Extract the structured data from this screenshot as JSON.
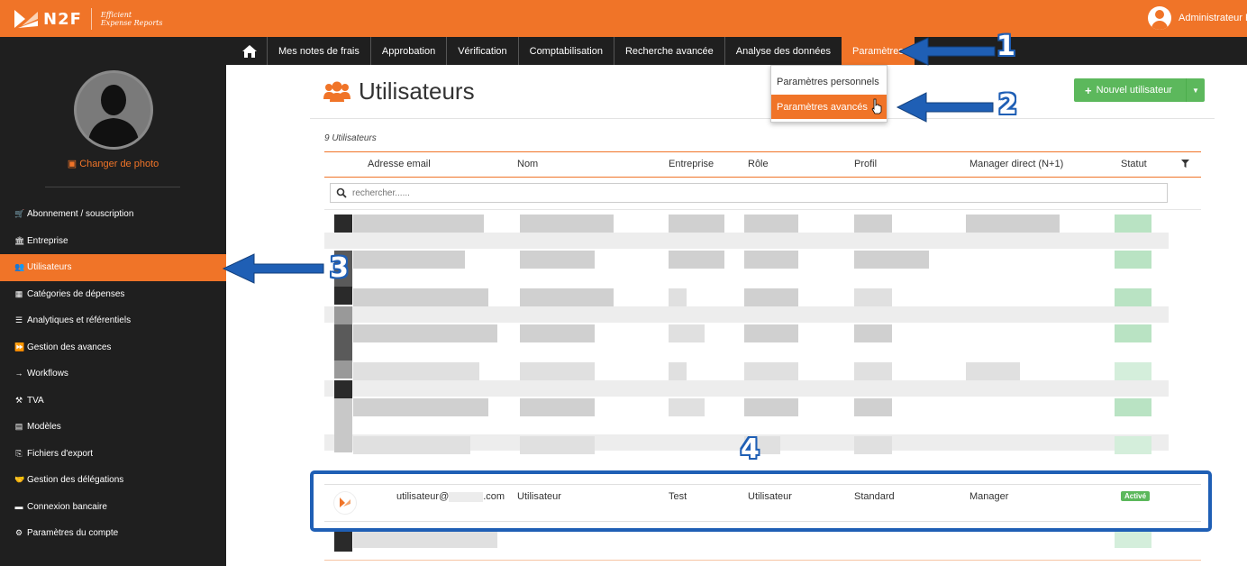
{
  "topbar": {
    "logo_text": "N2F",
    "tagline_1": "Efficient",
    "tagline_2": "Expense Reports",
    "user_label": "Administrateur R"
  },
  "nav": {
    "items": [
      "Mes notes de frais",
      "Approbation",
      "Vérification",
      "Comptabilisation",
      "Recherche avancée",
      "Analyse des données",
      "Paramètres"
    ],
    "active": "Paramètres"
  },
  "dropdown": {
    "items": [
      "Paramètres personnels",
      "Paramètres avancés"
    ],
    "active": "Paramètres avancés"
  },
  "sidebar": {
    "change_photo": "Changer de photo",
    "items": [
      {
        "label": "Abonnement / souscription",
        "icon": "cart-icon"
      },
      {
        "label": "Entreprise",
        "icon": "bank-icon"
      },
      {
        "label": "Utilisateurs",
        "icon": "users-icon"
      },
      {
        "label": "Catégories de dépenses",
        "icon": "grid-icon"
      },
      {
        "label": "Analytiques et référentiels",
        "icon": "list-icon"
      },
      {
        "label": "Gestion des avances",
        "icon": "fast-forward-icon"
      },
      {
        "label": "Workflows",
        "icon": "arrow-right-icon"
      },
      {
        "label": "TVA",
        "icon": "gavel-icon"
      },
      {
        "label": "Modèles",
        "icon": "template-icon"
      },
      {
        "label": "Fichiers d'export",
        "icon": "export-icon"
      },
      {
        "label": "Gestion des délégations",
        "icon": "handshake-icon"
      },
      {
        "label": "Connexion bancaire",
        "icon": "bank-card-icon"
      },
      {
        "label": "Paramètres du compte",
        "icon": "gears-icon"
      }
    ],
    "active": "Utilisateurs"
  },
  "page": {
    "title": "Utilisateurs",
    "new_user_label": "Nouvel utilisateur",
    "count_label": "9 Utilisateurs",
    "search_placeholder": "rechercher......"
  },
  "table": {
    "columns": [
      "Adresse email",
      "Nom",
      "Entreprise",
      "Rôle",
      "Profil",
      "Manager direct (N+1)",
      "Statut"
    ],
    "visible_row": {
      "email_prefix": "utilisateur@",
      "email_suffix": ".com",
      "name": "Utilisateur",
      "company": "Test",
      "role": "Utilisateur",
      "profile": "Standard",
      "manager": "Manager",
      "status": "Activé"
    }
  },
  "annotations": [
    "1",
    "2",
    "3",
    "4"
  ],
  "colors": {
    "brand_orange": "#f07428",
    "dark_bg": "#1f1f1f",
    "success_green": "#5cb85c",
    "annotation_blue": "#1f5fb5"
  }
}
